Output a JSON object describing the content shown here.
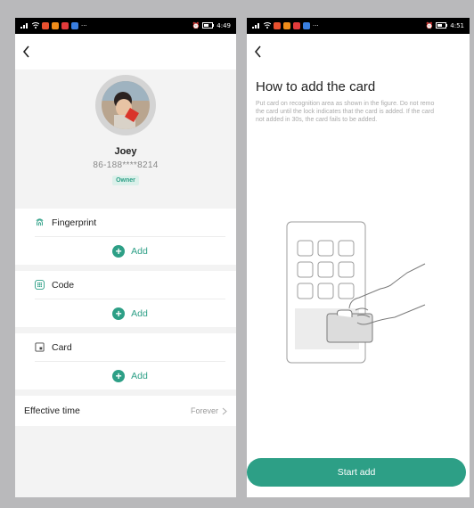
{
  "status_left": {
    "time": "4:49",
    "extra": "···"
  },
  "status_right": {
    "time": "4:51",
    "extra": "···"
  },
  "user": {
    "name": "Joey",
    "phone": "86-188****8214",
    "role": "Owner"
  },
  "sections": {
    "fingerprint": {
      "title": "Fingerprint",
      "add": "Add"
    },
    "code": {
      "title": "Code",
      "add": "Add"
    },
    "card": {
      "title": "Card",
      "add": "Add"
    }
  },
  "effective": {
    "label": "Effective time",
    "value": "Forever"
  },
  "guide": {
    "title": "How to add the card",
    "desc_line1": "Put card on recognition area as shown in the figure. Do not remo",
    "desc_line2": "the card until the lock indicates that the card is added. If the card",
    "desc_line3": "not added in 30s, the card fails to be added.",
    "start_button": "Start add"
  },
  "colors": {
    "accent": "#2d9f86",
    "badge_bg": "#dbf0ea",
    "screen_bg": "#f3f3f3",
    "frame_bg": "#b9b9bb"
  },
  "icons": {
    "back": "chevron-left-icon",
    "fingerprint": "fingerprint-icon",
    "code": "keypad-icon",
    "card": "card-icon",
    "add": "plus-circle-icon",
    "chevron": "chevron-right-icon"
  }
}
